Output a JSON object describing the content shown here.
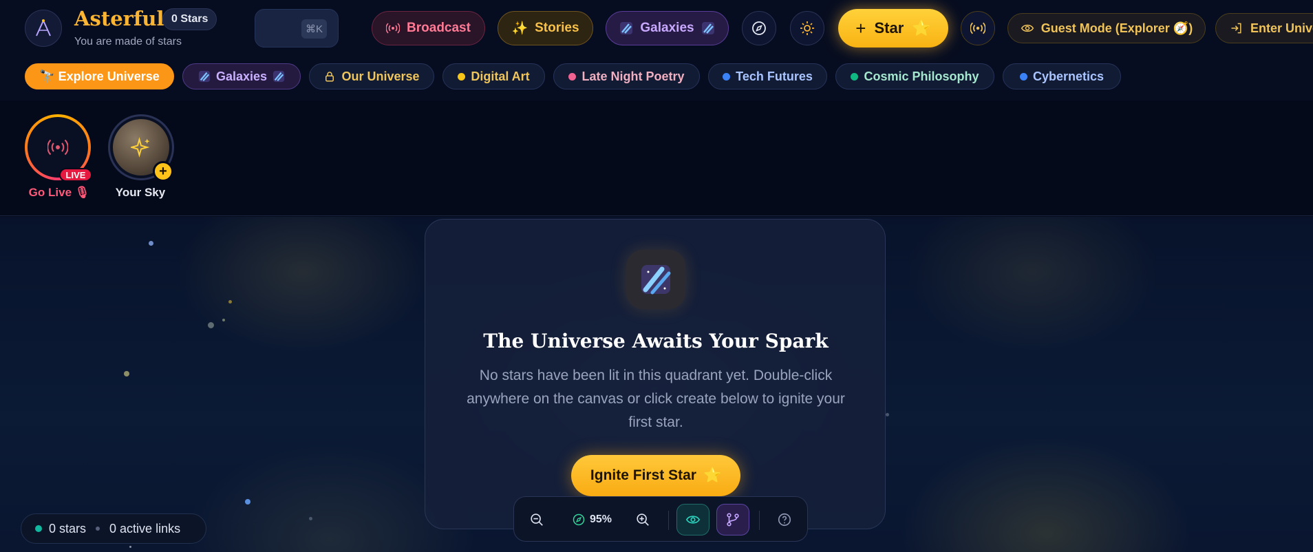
{
  "header": {
    "brand_name": "Asterful",
    "stars_count": "0 Stars",
    "tagline": "You are made of stars",
    "search_shortcut": "⌘K",
    "broadcast_label": "Broadcast",
    "stories_label": "Stories",
    "galaxies_label": "Galaxies",
    "star_label": "Star",
    "star_emoji": "⭐",
    "guest_label": "Guest Mode (Explorer 🧭)",
    "enter_label": "Enter Universe",
    "accent_color": "#fbb534"
  },
  "channels": [
    {
      "label": "🔭 Explore Universe",
      "active": true
    },
    {
      "label": "Galaxies",
      "icon": "galaxy-icon"
    },
    {
      "label": "Our Universe",
      "icon": "lock-icon"
    },
    {
      "label": "Digital Art",
      "dot": "#f5c518"
    },
    {
      "label": "Late Night Poetry",
      "dot": "#f06292"
    },
    {
      "label": "Tech Futures",
      "dot": "#3b82f6"
    },
    {
      "label": "Cosmic Philosophy",
      "dot": "#10b981"
    },
    {
      "label": "Cybernetics",
      "dot": "#3b82f6"
    }
  ],
  "stories": {
    "live_badge": "LIVE",
    "go_live_label": "Go Live 🎙",
    "your_sky_label": "Your Sky"
  },
  "empty_state": {
    "title": "The Universe Awaits Your Spark",
    "description": "No stars have been lit in this quadrant yet. Double-click anywhere on the canvas or click create below to ignite your first star.",
    "button_label": "Ignite First Star",
    "button_emoji": "⭐"
  },
  "toolbar": {
    "zoom_level": "95%"
  },
  "status": {
    "stars": "0 stars",
    "links": "0 active links"
  }
}
